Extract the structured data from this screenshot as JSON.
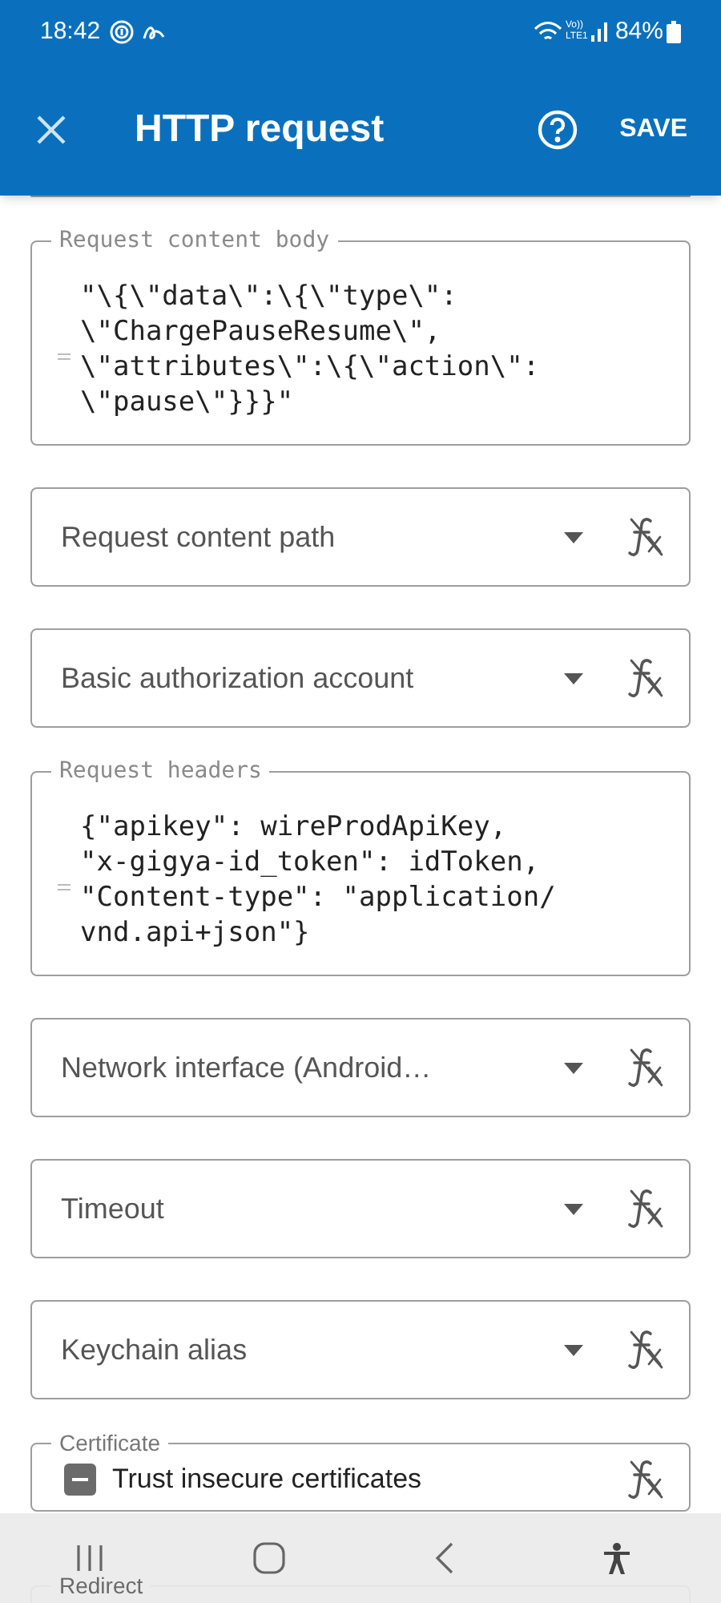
{
  "status_bar": {
    "time": "18:42",
    "battery": "84%",
    "network": "Vo)) LTE1"
  },
  "app_bar": {
    "title": "HTTP request",
    "action": "SAVE"
  },
  "fields": [
    {
      "kind": "multiline",
      "label": "Request content body",
      "value": "\"\\{\\\"data\\\":\\{\\\"type\\\":\n\\\"ChargePauseResume\\\",\n\\\"attributes\\\":\\{\\\"action\\\":\n\\\"pause\\\"}}}\""
    },
    {
      "kind": "dropdown",
      "placeholder": "Request content path"
    },
    {
      "kind": "dropdown",
      "placeholder": "Basic authorization account"
    },
    {
      "kind": "multiline",
      "label": "Request headers",
      "value": "{\"apikey\": wireProdApiKey,\n\"x-gigya-id_token\": idToken,\n\"Content-type\": \"application/\nvnd.api+json\"}"
    },
    {
      "kind": "dropdown",
      "placeholder": "Network interface (Android…"
    },
    {
      "kind": "dropdown",
      "placeholder": "Timeout"
    },
    {
      "kind": "dropdown",
      "placeholder": "Keychain alias"
    },
    {
      "kind": "checkbox",
      "label": "Certificate",
      "text": "Trust insecure certificates",
      "indeterminate": true
    },
    {
      "kind": "partial",
      "label": "Redirect"
    }
  ]
}
